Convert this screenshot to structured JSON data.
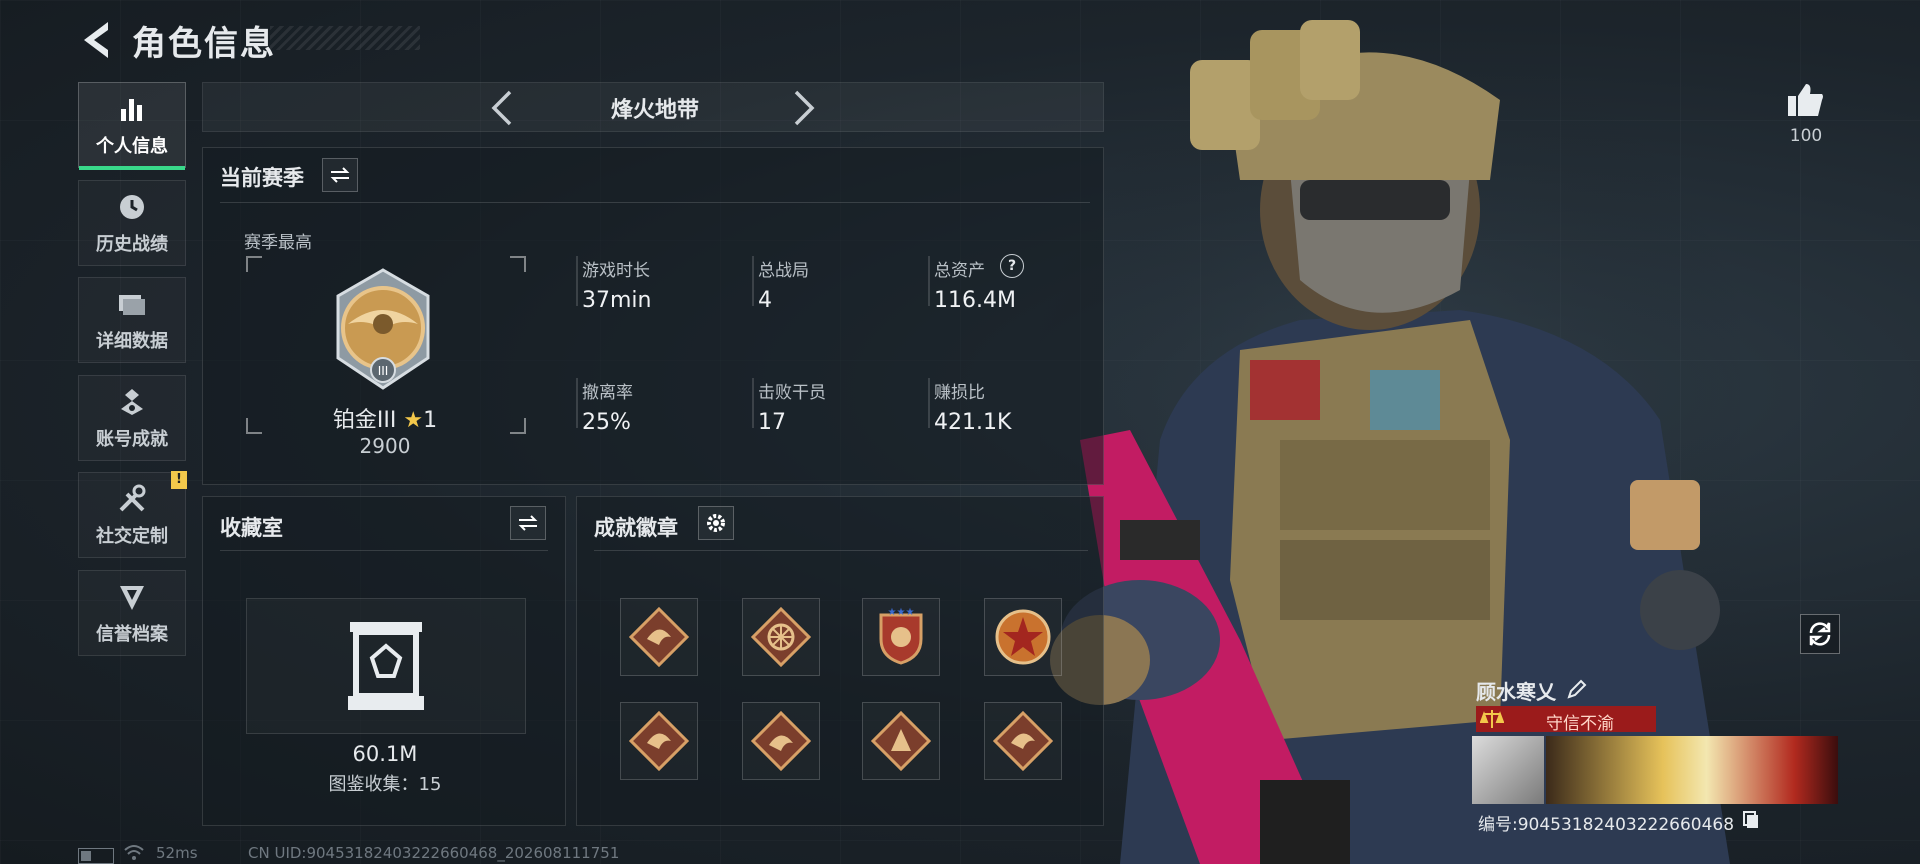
{
  "header": {
    "title": "角色信息"
  },
  "sidebar": {
    "items": [
      {
        "label": "个人信息",
        "icon": "bar-chart-icon",
        "active": true
      },
      {
        "label": "历史战绩",
        "icon": "clock-icon",
        "active": false
      },
      {
        "label": "详细数据",
        "icon": "folder-icon",
        "active": false
      },
      {
        "label": "账号成就",
        "icon": "achievement-icon",
        "active": false
      },
      {
        "label": "社交定制",
        "icon": "tools-icon",
        "active": false,
        "alert": "!"
      },
      {
        "label": "信誉档案",
        "icon": "credit-icon",
        "active": false
      }
    ]
  },
  "map": {
    "name": "烽火地带"
  },
  "season": {
    "title": "当前赛季",
    "best_label": "赛季最高",
    "rank_name": "铂金III",
    "rank_stars": "1",
    "rank_score": "2900",
    "stats": [
      {
        "label": "游戏时长",
        "value": "37min"
      },
      {
        "label": "总战局",
        "value": "4"
      },
      {
        "label": "总资产",
        "value": "116.4M",
        "help": "?"
      },
      {
        "label": "撤离率",
        "value": "25%"
      },
      {
        "label": "击败干员",
        "value": "17"
      },
      {
        "label": "赚损比",
        "value": "421.1K"
      }
    ]
  },
  "collection": {
    "title": "收藏室",
    "value": "60.1M",
    "progress_text": "图鉴收集：15"
  },
  "achievements": {
    "title": "成就徽章",
    "badges": [
      "dragon-badge",
      "wheel-badge",
      "shield-badge",
      "star-badge",
      "dragon-badge",
      "dragon-badge",
      "figure-badge",
      "dragon-badge"
    ]
  },
  "likes": {
    "count": "100"
  },
  "player": {
    "name": "顾水寒乂",
    "title": "守信不渝",
    "id_text": "编号:9045318240322266046​8"
  },
  "footer": {
    "ping": "52ms",
    "uid": "CN UID:9045318240322266046​8_202608111751"
  },
  "colors": {
    "accent_green": "#39d98a",
    "warn_yellow": "#f3c84b",
    "title_red": "#9b1b1b"
  }
}
